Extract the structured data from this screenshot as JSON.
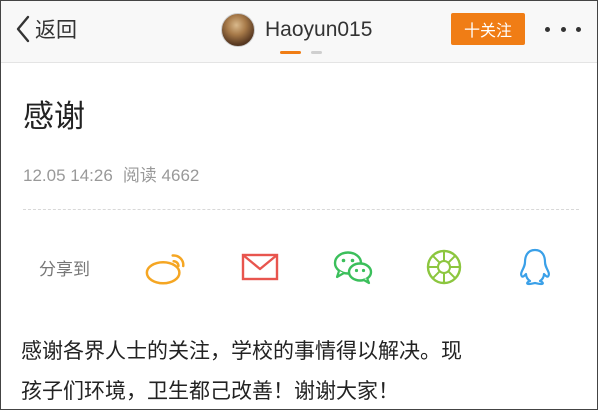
{
  "nav": {
    "back_label": "返回",
    "username": "Haoyun015",
    "follow_label": "十关注",
    "accent_color": "#f07d15"
  },
  "post": {
    "title": "感谢",
    "date": "12.05 14:26",
    "read_label": "阅读",
    "read_count": "4662",
    "body_lines": [
      "感谢各界人士的关注，学校的事情得以解决。现",
      "孩子们环境，卫生都己改善！谢谢大家！"
    ]
  },
  "share": {
    "label": "分享到",
    "targets": [
      {
        "icon": "weibo-icon",
        "color": "#f5a623"
      },
      {
        "icon": "mail-icon",
        "color": "#e8554e"
      },
      {
        "icon": "wechat-icon",
        "color": "#3bbf5b"
      },
      {
        "icon": "moments-icon",
        "color": "#8cc63f"
      },
      {
        "icon": "qq-icon",
        "color": "#3aa0e8"
      }
    ]
  }
}
